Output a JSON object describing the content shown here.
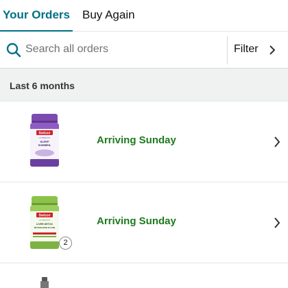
{
  "tabs": {
    "your_orders": "Your Orders",
    "buy_again": "Buy Again"
  },
  "search": {
    "placeholder": "Search all orders",
    "value": "",
    "filter_label": "Filter"
  },
  "section": {
    "title": "Last 6 months"
  },
  "orders": [
    {
      "status": "Arriving Sunday",
      "product": {
        "brand": "Swisse",
        "line": "ULTIBOOST",
        "name_line1": "SLEEP",
        "name_line2": "SOMMEIL",
        "cap_color": "#7b4bb0"
      }
    },
    {
      "status": "Arriving Sunday",
      "quantity": "2",
      "product": {
        "brand": "Swisse",
        "line": "ULTIBOOST",
        "name_line1": "LIVER DETOX",
        "name_line2": "DÉTOXICATION DU FOIE",
        "cap_color": "#8bc34a"
      }
    }
  ],
  "colors": {
    "accent": "#007185",
    "status_green": "#1e7a1e",
    "section_bg": "#f0f2f2"
  },
  "icons": {
    "search": "search-icon",
    "filter_chevron": "chevron-right-icon",
    "row_chevron": "chevron-right-icon"
  }
}
